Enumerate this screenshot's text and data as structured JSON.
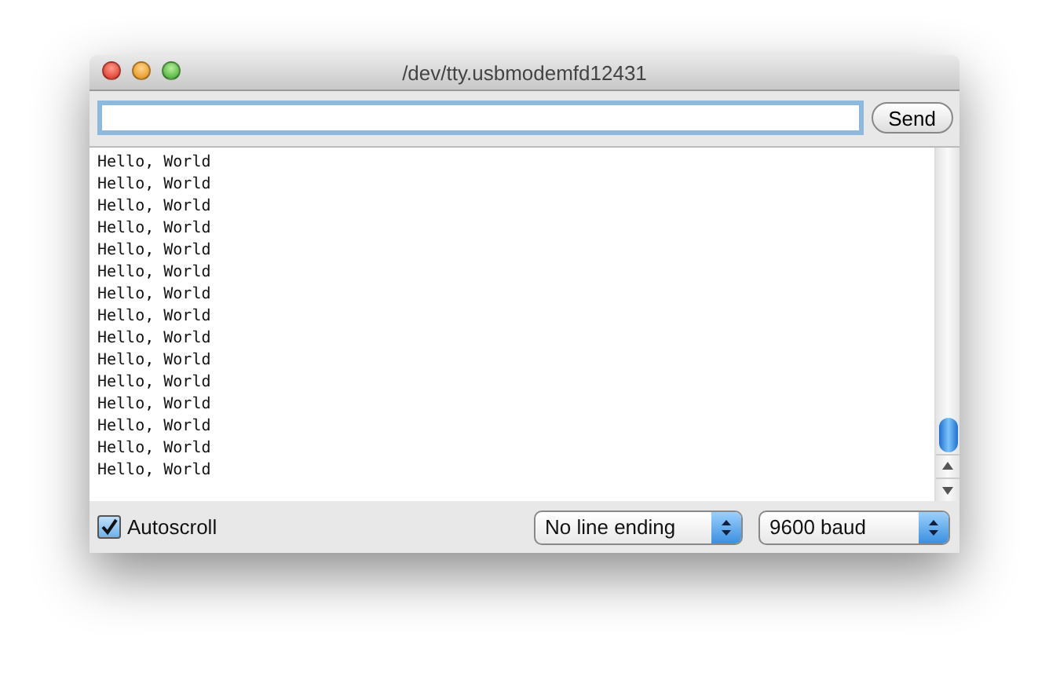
{
  "window": {
    "title": "/dev/tty.usbmodemfd12431"
  },
  "send_button": {
    "label": "Send"
  },
  "output_lines": [
    "Hello, World",
    "Hello, World",
    "Hello, World",
    "Hello, World",
    "Hello, World",
    "Hello, World",
    "Hello, World",
    "Hello, World",
    "Hello, World",
    "Hello, World",
    "Hello, World",
    "Hello, World",
    "Hello, World",
    "Hello, World",
    "Hello, World"
  ],
  "autoscroll": {
    "label": "Autoscroll",
    "checked": true
  },
  "line_ending": {
    "value": "No line ending"
  },
  "baud": {
    "value": "9600 baud"
  }
}
